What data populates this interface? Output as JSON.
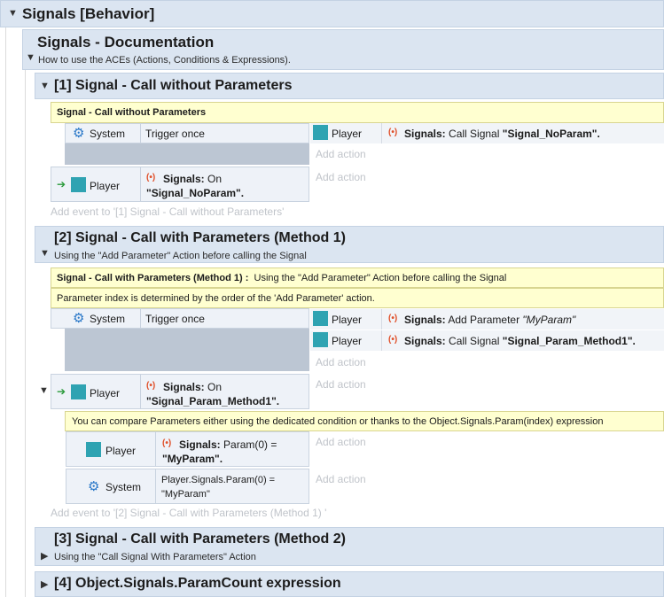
{
  "root": {
    "title": "Signals [Behavior]"
  },
  "doc": {
    "title": "Signals - Documentation",
    "subtitle": "How to use the ACEs (Actions, Conditions & Expressions)."
  },
  "g1": {
    "title": "[1] Signal - Call without Parameters",
    "note": "Signal - Call without Parameters",
    "cond1_obj": "System",
    "cond1_text": "Trigger once",
    "act1_obj": "Player",
    "act1_prefix": "Signals:",
    "act1_text": "Call Signal",
    "act1_value": "\"Signal_NoParam\".",
    "add_action": "Add action",
    "cond2_obj": "Player",
    "cond2_prefix": "Signals:",
    "cond2_text": "On",
    "cond2_value": "\"Signal_NoParam\".",
    "add_action2": "Add action",
    "add_event": "Add event to '[1] Signal - Call without Parameters'"
  },
  "g2": {
    "title": "[2] Signal - Call with Parameters (Method 1)",
    "subtitle": "Using the \"Add Parameter\" Action before calling the Signal",
    "note1_bold": "Signal - Call with Parameters (Method 1) :",
    "note1_text": "Using the \"Add Parameter\" Action before calling the Signal",
    "note2": "Parameter index is determined by the order of the 'Add Parameter' action.",
    "cond1_obj": "System",
    "cond1_text": "Trigger once",
    "act1_obj": "Player",
    "act1_prefix": "Signals:",
    "act1_text": "Add Parameter",
    "act1_value": "\"MyParam\"",
    "act2_obj": "Player",
    "act2_prefix": "Signals:",
    "act2_text": "Call Signal",
    "act2_value": "\"Signal_Param_Method1\".",
    "add_action": "Add action",
    "cond2_obj": "Player",
    "cond2_prefix": "Signals:",
    "cond2_text": "On",
    "cond2_value": "\"Signal_Param_Method1\".",
    "add_action2": "Add action",
    "note3": "You can compare Parameters either using the dedicated condition or thanks to the Object.Signals.Param(index) expression",
    "sub1_obj": "Player",
    "sub1_prefix": "Signals:",
    "sub1_text": "Param(0) =",
    "sub1_value": "\"MyParam\".",
    "add_action3": "Add action",
    "sub2_obj": "System",
    "sub2_line1": "Player.Signals.Param(0) =",
    "sub2_line2": "\"MyParam\"",
    "add_action4": "Add action",
    "add_event": "Add event to '[2] Signal - Call with Parameters (Method 1) '"
  },
  "g3": {
    "title": "[3] Signal - Call with Parameters (Method 2)",
    "subtitle": "Using the \"Call Signal With Parameters\" Action"
  },
  "g4": {
    "title": "[4] Object.Signals.ParamCount expression"
  },
  "colors": {
    "header": "#dbe5f1",
    "note": "#ffffd0",
    "player_icon": "#2fa3b2",
    "signal_icon": "#e0502a",
    "gear_icon": "#2a78c8"
  },
  "icons": [
    "gear-icon",
    "player-icon",
    "signal-icon",
    "trigger-arrow-icon",
    "expand-triangle-icon",
    "collapse-triangle-icon"
  ]
}
